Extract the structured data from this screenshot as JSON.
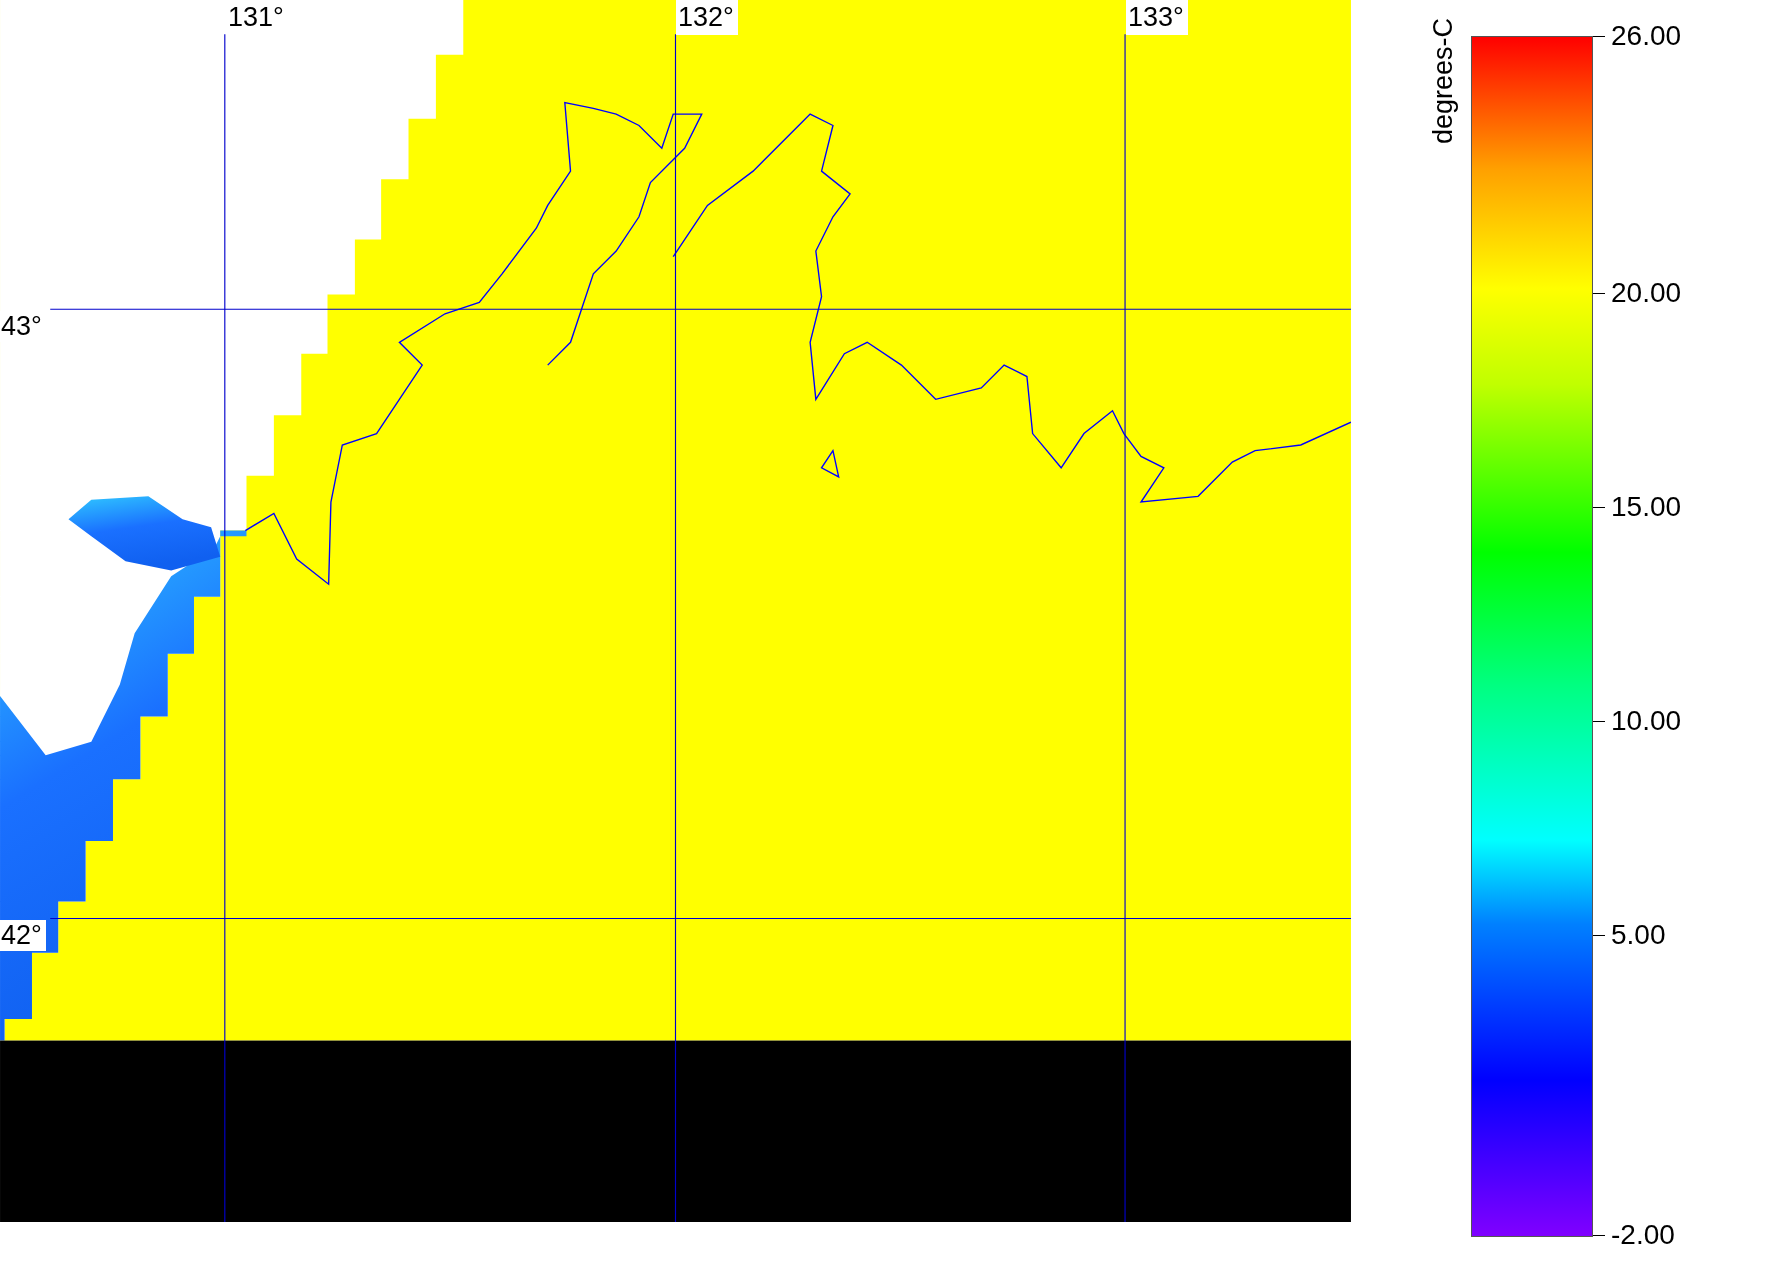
{
  "map": {
    "longitude_labels": [
      "131°",
      "132°",
      "133°"
    ],
    "latitude_labels": [
      "43°",
      "42°"
    ]
  },
  "colorbar": {
    "unit": "degrees-C",
    "ticks": [
      "26.00",
      "20.00",
      "15.00",
      "10.00",
      "5.00",
      "-2.00"
    ]
  }
}
